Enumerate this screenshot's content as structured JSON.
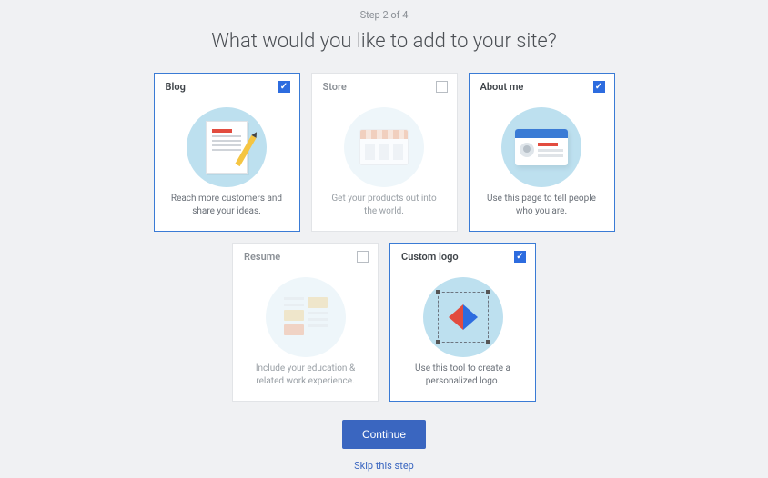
{
  "step": "Step 2 of 4",
  "heading": "What would you like to add to your site?",
  "cards": [
    {
      "title": "Blog",
      "desc": "Reach more customers and share your ideas.",
      "selected": true
    },
    {
      "title": "Store",
      "desc": "Get your products out into the world.",
      "selected": false
    },
    {
      "title": "About me",
      "desc": "Use this page to tell people who you are.",
      "selected": true
    },
    {
      "title": "Resume",
      "desc": "Include your education & related work experience.",
      "selected": false
    },
    {
      "title": "Custom logo",
      "desc": "Use this tool to create a personalized logo.",
      "selected": true
    }
  ],
  "actions": {
    "continue": "Continue",
    "skip": "Skip this step"
  }
}
